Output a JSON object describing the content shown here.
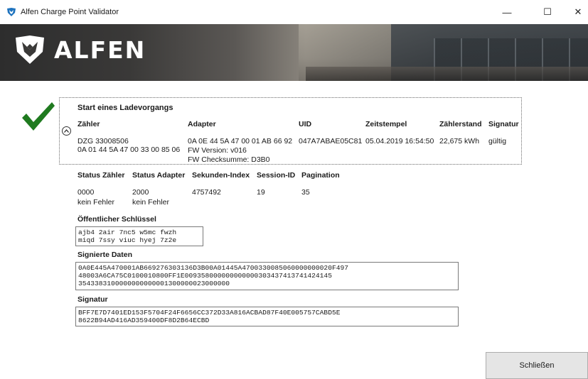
{
  "window": {
    "title": "Alfen Charge Point Validator",
    "minimize_glyph": "—",
    "maximize_glyph": "☐",
    "close_glyph": "✕"
  },
  "banner": {
    "logo_text": "ALFEN"
  },
  "status": {
    "icon": "check-icon",
    "color": "#1f7a1f"
  },
  "session": {
    "heading": "Start eines Ladevorgangs",
    "columns": [
      "Zähler",
      "Adapter",
      "UID",
      "Zeitstempel",
      "Zählerstand",
      "Signatur"
    ],
    "meter": [
      "DZG 33008506",
      "0A 01 44 5A 47 00 33 00 85 06"
    ],
    "adapter": [
      "0A 0E 44 5A 47 00 01 AB 66 92",
      "FW Version: v016",
      "FW Checksumme: D3B0"
    ],
    "uid": "047A7ABAE05C81",
    "timestamp": "05.04.2019 16:54:50",
    "reading": "22,675 kWh",
    "signature_status": "gültig"
  },
  "details": {
    "columns": [
      "Status Zähler",
      "Status Adapter",
      "Sekunden-Index",
      "Session-ID",
      "Pagination"
    ],
    "status_meter": [
      "0000",
      "kein Fehler"
    ],
    "status_adapter": [
      "2000",
      "kein Fehler"
    ],
    "seconds_index": "4757492",
    "session_id": "19",
    "pagination": "35"
  },
  "public_key": {
    "label": "Öffentlicher Schlüssel",
    "value": "ajb4 2air 7nc5 w5mc fwzh\nmiqd 7ssy viuc hyej 7z2e"
  },
  "signed_data": {
    "label": "Signierte Daten",
    "value": "0A0E445A470001AB669276303136D3B00A01445A4700330085060000000020F497\n48003A6CA75C0100010800FF1E009358000000000000303437413741424145\n3543383100000000000001300000023000000"
  },
  "signature": {
    "label": "Signatur",
    "value": "BFF7E7D7401ED153F5704F24F6656CC372D33A816ACBAD87F40E005757CABD5E\n8622B94AD416AD359400DF8D2B64ECBD"
  },
  "buttons": {
    "close": "Schließen"
  },
  "colors": {
    "accent_blue": "#1e73be",
    "check_green": "#1f7a1f"
  }
}
